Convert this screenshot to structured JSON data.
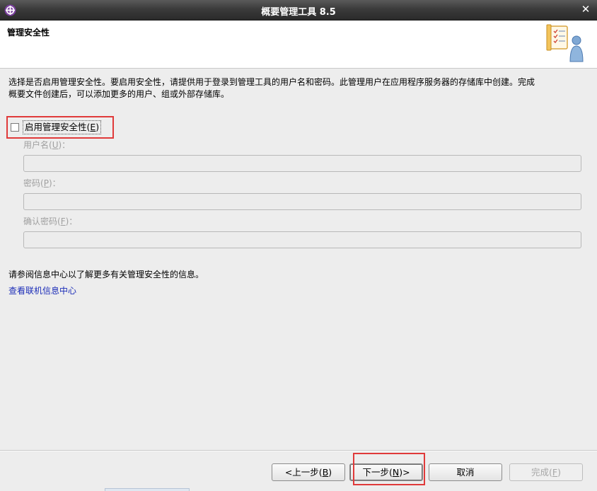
{
  "window": {
    "title": "概要管理工具 8.5",
    "close_glyph": "✕",
    "app_icon": "eclipse-cross-icon"
  },
  "banner": {
    "title": "管理安全性",
    "graphic": "checklist-user-icon"
  },
  "description": {
    "line1": "选择是否启用管理安全性。要启用安全性，请提供用于登录到管理工具的用户名和密码。此管理用户在应用程序服务器的存储库中创建。完成",
    "line2": "概要文件创建后，可以添加更多的用户、组或外部存储库。"
  },
  "enable_security": {
    "label": "启用管理安全性(",
    "mnemonic": "E",
    "label_end": ")",
    "checked": false
  },
  "fields": {
    "username": {
      "label": "用户名(",
      "mnemonic": "U",
      "label_end": ")：",
      "value": ""
    },
    "password": {
      "label": "密码(",
      "mnemonic": "P",
      "label_end": ")：",
      "value": ""
    },
    "confirm_password": {
      "label": "确认密码(",
      "mnemonic": "F",
      "label_end": ")：",
      "value": ""
    }
  },
  "info": {
    "text": "请参阅信息中心以了解更多有关管理安全性的信息。",
    "link": "查看联机信息中心"
  },
  "buttons": {
    "back": {
      "pre": "<上一步(",
      "mnemonic": "B",
      "post": ")"
    },
    "next": {
      "pre": "下一步(",
      "mnemonic": "N",
      "post": ")>"
    },
    "cancel": "取消",
    "finish": {
      "pre": "完成(",
      "mnemonic": "F",
      "post": ")"
    }
  },
  "colors": {
    "highlight": "#e03a3a",
    "link": "#1c2db8",
    "disabled_text": "#a0a0a0"
  }
}
